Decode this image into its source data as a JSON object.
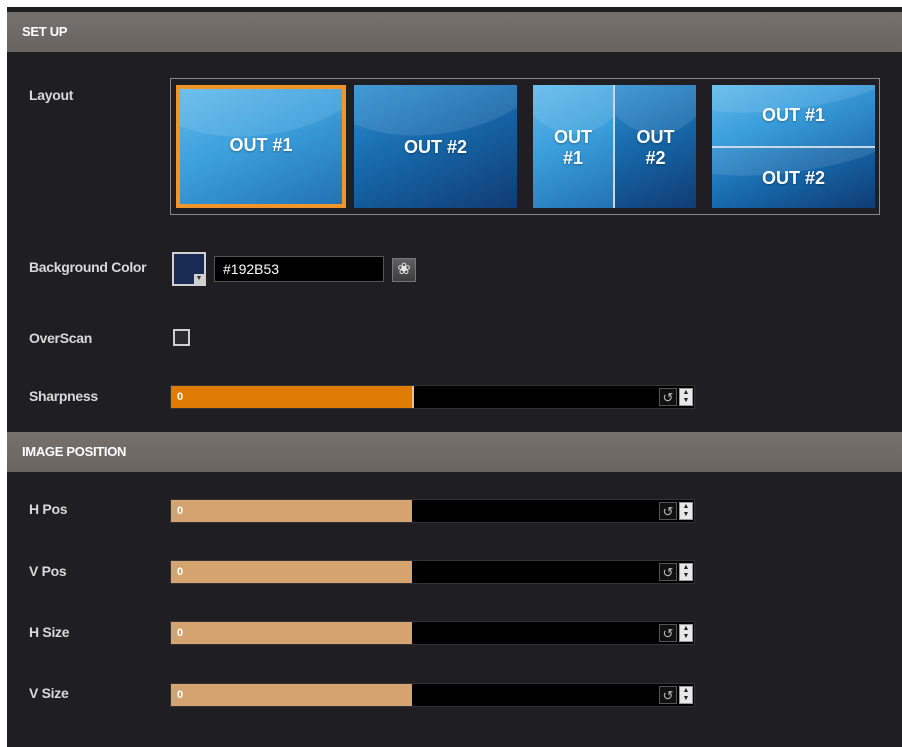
{
  "setup": {
    "header": "SET UP",
    "layout_label": "Layout",
    "layouts": [
      {
        "name": "single-out1",
        "lines": [
          "OUT #1"
        ],
        "selected": true
      },
      {
        "name": "single-out2",
        "lines": [
          "OUT #2"
        ],
        "selected": false
      },
      {
        "name": "side-by-side",
        "left": [
          "OUT",
          "#1"
        ],
        "right": [
          "OUT",
          "#2"
        ],
        "selected": false
      },
      {
        "name": "stacked",
        "top": "OUT #1",
        "bottom": "OUT #2",
        "selected": false
      }
    ],
    "background_color_label": "Background Color",
    "background_color_value": "#192B53",
    "overscan_label": "OverScan",
    "overscan_checked": false,
    "sharpness_label": "Sharpness",
    "sharpness_value": "0",
    "sharpness_fill_fraction": 0.46
  },
  "image_position": {
    "header": "IMAGE POSITION",
    "h_pos_label": "H Pos",
    "h_pos_value": "0",
    "v_pos_label": "V Pos",
    "v_pos_value": "0",
    "h_size_label": "H Size",
    "h_size_value": "0",
    "v_size_label": "V Size",
    "v_size_value": "0",
    "fill_fraction": 0.46
  },
  "icons": {
    "reset": "reset-icon",
    "spin_up": "chevron-up-icon",
    "spin_down": "chevron-down-icon",
    "picker": "color-palette-icon"
  },
  "colors": {
    "panel_bg": "#1f1e22",
    "header_bg": "#6a6460",
    "accent_orange": "#e07b04",
    "slider_tan": "#d5a370",
    "selected_border": "#f0952a"
  }
}
